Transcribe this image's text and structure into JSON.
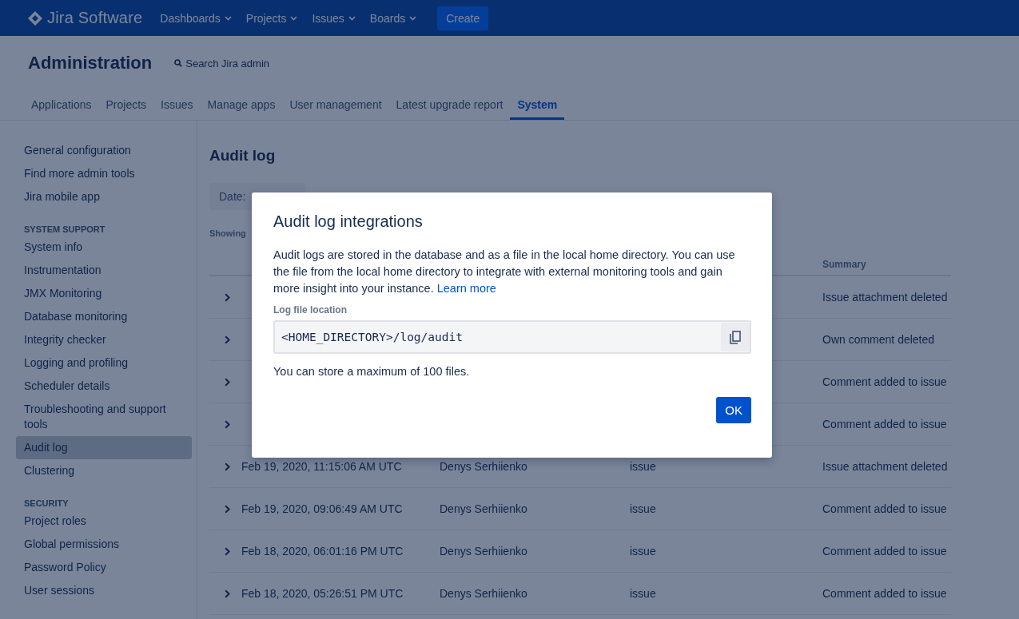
{
  "top_nav": {
    "logo": "Jira Software",
    "menus": [
      {
        "label": "Dashboards"
      },
      {
        "label": "Projects"
      },
      {
        "label": "Issues"
      },
      {
        "label": "Boards"
      }
    ],
    "create_button": "Create"
  },
  "header": {
    "title": "Administration",
    "search": {
      "placeholder": "Search Jira admin"
    }
  },
  "tabs": [
    {
      "label": "Applications",
      "selected": false
    },
    {
      "label": "Projects",
      "selected": false
    },
    {
      "label": "Issues",
      "selected": false
    },
    {
      "label": "Manage apps",
      "selected": false
    },
    {
      "label": "User management",
      "selected": false
    },
    {
      "label": "Latest upgrade report",
      "selected": false
    },
    {
      "label": "System",
      "selected": true
    }
  ],
  "sidebar": {
    "sections": [
      {
        "items": [
          {
            "label": "General configuration",
            "selected": false
          },
          {
            "label": "Find more admin tools",
            "selected": false
          },
          {
            "label": "Jira mobile app",
            "selected": false
          }
        ]
      },
      {
        "heading": "SYSTEM SUPPORT",
        "items": [
          {
            "label": "System info",
            "selected": false
          },
          {
            "label": "Instrumentation",
            "selected": false
          },
          {
            "label": "JMX Monitoring",
            "selected": false
          },
          {
            "label": "Database monitoring",
            "selected": false
          },
          {
            "label": "Integrity checker",
            "selected": false
          },
          {
            "label": "Logging and profiling",
            "selected": false
          },
          {
            "label": "Scheduler details",
            "selected": false
          },
          {
            "label": "Troubleshooting and support tools",
            "selected": false
          },
          {
            "label": "Audit log",
            "selected": true
          },
          {
            "label": "Clustering",
            "selected": false
          }
        ]
      },
      {
        "heading": "SECURITY",
        "items": [
          {
            "label": "Project roles",
            "selected": false
          },
          {
            "label": "Global permissions",
            "selected": false
          },
          {
            "label": "Password Policy",
            "selected": false
          },
          {
            "label": "User sessions",
            "selected": false
          }
        ]
      }
    ]
  },
  "main": {
    "title": "Audit log",
    "date_filter": "Date:",
    "showing": "Showing",
    "table": {
      "summary_header": "Summary",
      "rows": [
        {
          "summary": "Issue attachment deleted"
        },
        {
          "summary": "Own comment deleted"
        },
        {
          "summary": "Comment added to issue"
        },
        {
          "summary": "Comment added to issue"
        },
        {
          "date": "Feb 19, 2020, 11:15:06 AM UTC",
          "author": "Denys Serhiienko",
          "category": "issue",
          "summary": "Issue attachment deleted"
        },
        {
          "date": "Feb 19, 2020, 09:06:49 AM UTC",
          "author": "Denys Serhiienko",
          "category": "issue",
          "summary": "Comment added to issue"
        },
        {
          "date": "Feb 18, 2020, 06:01:16 PM UTC",
          "author": "Denys Serhiienko",
          "category": "issue",
          "summary": "Comment added to issue"
        },
        {
          "date": "Feb 18, 2020, 05:26:51 PM UTC",
          "author": "Denys Serhiienko",
          "category": "issue",
          "summary": "Comment added to issue"
        }
      ]
    }
  },
  "modal": {
    "title": "Audit log integrations",
    "body": "Audit logs are stored in the database and as a file in the local home directory. You can use the file from the local home directory to integrate with external monitoring tools and gain more insight into your instance.",
    "link": "Learn more",
    "field_label": "Log file location",
    "field_value": "<HOME_DIRECTORY>/log/audit",
    "note": "You can store a maximum of 100 files.",
    "ok_button": "OK"
  }
}
